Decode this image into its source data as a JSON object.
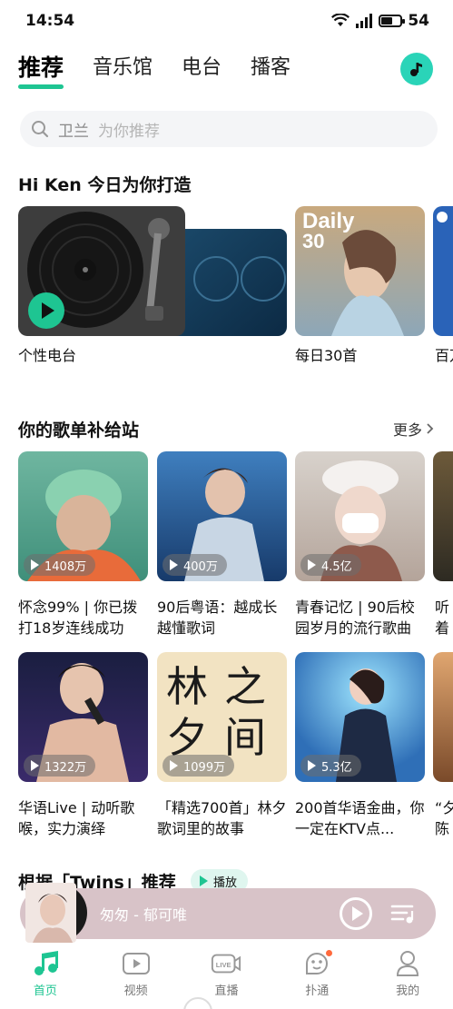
{
  "status": {
    "time": "14:54",
    "battery": "54",
    "network": "5G"
  },
  "tabs": [
    {
      "label": "推荐",
      "active": true
    },
    {
      "label": "音乐馆",
      "active": false
    },
    {
      "label": "电台",
      "active": false
    },
    {
      "label": "播客",
      "active": false
    }
  ],
  "search": {
    "keyword": "卫兰",
    "hint": "为你推荐"
  },
  "daily_section": {
    "title": "Hi Ken  今日为你打造",
    "cards": [
      {
        "label": "个性电台"
      },
      {
        "label": "每日30首",
        "badge_line1": "Daily",
        "badge_line2": "30"
      },
      {
        "label": "百万"
      }
    ]
  },
  "playlist_section": {
    "title": "你的歌单补给站",
    "more": "更多",
    "items": [
      {
        "title": "怀念99% | 你已拨打18岁连线成功",
        "count": "1408万"
      },
      {
        "title": "90后粤语：越成长越懂歌词",
        "count": "400万"
      },
      {
        "title": "青春记忆 | 90后校园岁月的流行歌曲",
        "count": "4.5亿"
      },
      {
        "title": "听着港语",
        "count": ""
      },
      {
        "title": "华语Live | 动听歌喉，实力演绎",
        "count": "1322万"
      },
      {
        "title": "「精选700首」林夕歌词里的故事",
        "count": "1099万",
        "cover_text1": "林",
        "cover_text2": "夕",
        "cover_text3": "之",
        "cover_text4": "间"
      },
      {
        "title": "200首华语金曲，你一定在KTV点...",
        "count": "5.3亿"
      },
      {
        "title": "“夕陈精",
        "count": ""
      }
    ]
  },
  "twins_section": {
    "title": "根据「Twins」推荐",
    "play": "播放"
  },
  "mini_player": {
    "song": "匆匆 - 郁可唯"
  },
  "nav": [
    {
      "label": "首页",
      "icon": "music-note-icon",
      "active": true
    },
    {
      "label": "视频",
      "icon": "video-icon",
      "active": false
    },
    {
      "label": "直播",
      "icon": "live-icon",
      "active": false
    },
    {
      "label": "扑通",
      "icon": "face-icon",
      "active": false
    },
    {
      "label": "我的",
      "icon": "person-icon",
      "active": false
    }
  ],
  "colors": {
    "accent": "#1ec592",
    "mini_player_bg": "#d8c3c8"
  }
}
